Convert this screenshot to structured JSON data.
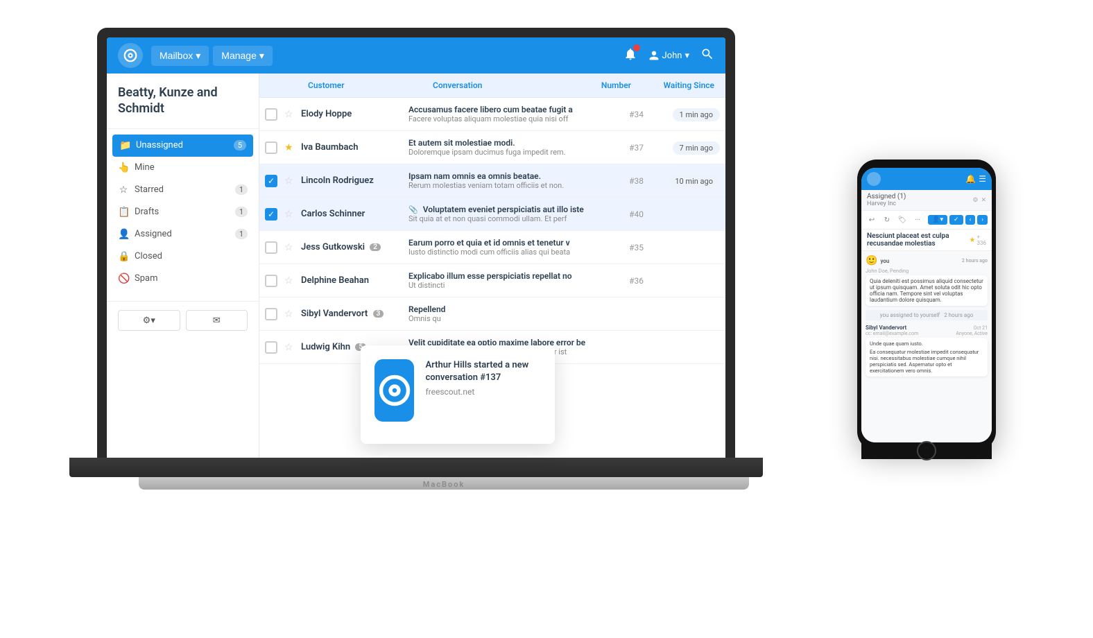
{
  "app": {
    "logo_alt": "FreeScout",
    "nav": {
      "mailbox_label": "Mailbox",
      "manage_label": "Manage",
      "user_label": "John"
    }
  },
  "sidebar": {
    "company": "Beatty, Kunze and Schmidt",
    "items": [
      {
        "id": "unassigned",
        "label": "Unassigned",
        "badge": "5",
        "active": true
      },
      {
        "id": "mine",
        "label": "Mine",
        "badge": "",
        "active": false
      },
      {
        "id": "starred",
        "label": "Starred",
        "badge": "1",
        "active": false
      },
      {
        "id": "drafts",
        "label": "Drafts",
        "badge": "1",
        "active": false
      },
      {
        "id": "assigned",
        "label": "Assigned",
        "badge": "1",
        "active": false
      },
      {
        "id": "closed",
        "label": "Closed",
        "badge": "",
        "active": false
      },
      {
        "id": "spam",
        "label": "Spam",
        "badge": "",
        "active": false
      }
    ],
    "bottom_settings": "⚙",
    "bottom_compose": "✉"
  },
  "conversation_list": {
    "headers": {
      "customer": "Customer",
      "conversation": "Conversation",
      "number": "Number",
      "waiting_since": "Waiting Since"
    },
    "rows": [
      {
        "id": 1,
        "customer": "Elody Hoppe",
        "starred": false,
        "subject": "Accusamus facere libero cum beatae fugit a",
        "preview": "Facere voluptas aliquam molestiae quia nisi off",
        "number": "#34",
        "waiting": "1 min ago",
        "checked": false,
        "has_attachment": false,
        "badge": null
      },
      {
        "id": 2,
        "customer": "Iva Baumbach",
        "starred": true,
        "subject": "Et autem sit molestiae modi.",
        "preview": "Doloremque ipsam ducimus fuga impedit rem.",
        "number": "#37",
        "waiting": "7 min ago",
        "checked": false,
        "has_attachment": false,
        "badge": null
      },
      {
        "id": 3,
        "customer": "Lincoln Rodriguez",
        "starred": false,
        "subject": "Ipsam nam omnis ea omnis beatae.",
        "preview": "Rerum molestias veniam totam officiis et non.",
        "number": "#38",
        "waiting": "10 min ago",
        "checked": true,
        "has_attachment": false,
        "badge": null
      },
      {
        "id": 4,
        "customer": "Carlos Schinner",
        "starred": false,
        "subject": "Voluptatem eveniet perspiciatis aut illo iste",
        "preview": "Sit quia at et non quasi commodi ullam. Et perf",
        "number": "#40",
        "waiting": "",
        "checked": true,
        "has_attachment": true,
        "badge": null
      },
      {
        "id": 5,
        "customer": "Jess Gutkowski",
        "starred": false,
        "subject": "Earum porro et quia et id omnis et tenetur v",
        "preview": "Iusto distinctio modi cum officiis alias qui beata",
        "number": "#35",
        "waiting": "",
        "checked": false,
        "has_attachment": false,
        "badge": "2"
      },
      {
        "id": 6,
        "customer": "Delphine Beahan",
        "starred": false,
        "subject": "Explicabo illum esse perspiciatis repellat no",
        "preview": "Ut distincti",
        "number": "#36",
        "waiting": "",
        "checked": false,
        "has_attachment": false,
        "badge": null
      },
      {
        "id": 7,
        "customer": "Sibyl Vandervort",
        "starred": false,
        "subject": "Repellend",
        "preview": "Omnis qu",
        "number": "",
        "waiting": "",
        "checked": false,
        "has_attachment": false,
        "badge": "3"
      },
      {
        "id": 8,
        "customer": "Ludwig Kihn",
        "starred": false,
        "subject": "Velit cupiditate ea optio maxime labore error be",
        "preview": "Optio autem ipsam error minima ea pariatur ist",
        "number": "",
        "waiting": "",
        "checked": false,
        "has_attachment": false,
        "badge": "5"
      }
    ]
  },
  "freescout_popup": {
    "notification": "Arthur Hills started a new conversation #137",
    "domain": "freescout.net"
  },
  "phone": {
    "assigned_label": "Assigned (1)",
    "company": "Harvey Inc",
    "conversation_title": "Nesciunt placeat est culpa recusandae molestias",
    "star_count": "+ 336",
    "messages": [
      {
        "author": "you",
        "time": "2 hours ago",
        "meta": "John Doe, Pending",
        "text": "Quia deleniti est possimus aliquid consectetur ut ipsum quisquam. Amet soluta odit hic opto officia nam. Tempore sint vel voluptas laudantium dolore quisquam."
      }
    ],
    "activity": "you assigned to yourself",
    "activity_time": "2 hours ago",
    "sender": {
      "name": "Sibyl Vandervort",
      "email": "cc: email@example.com",
      "date": "Oct 21",
      "status": "Anyone, Active",
      "text": "Unde quae quam iusto.\n\nEa consequatur molestiae impedit consequatur nisi. necessitabus molestiae cumque nihil perspiciatis sed. Aspernatur opto et exercitationem vero omnis."
    }
  },
  "laptop_label": "MacBook"
}
